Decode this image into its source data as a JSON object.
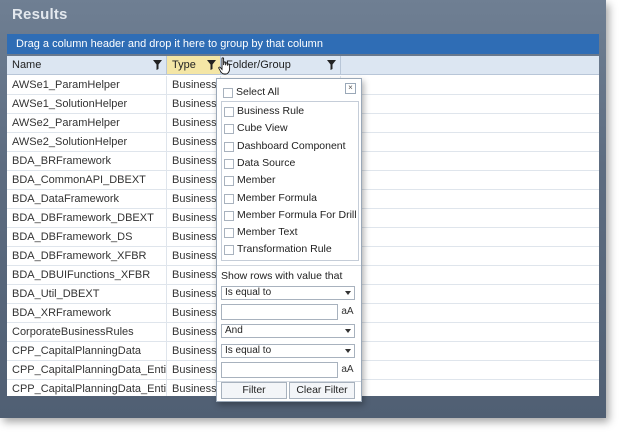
{
  "window": {
    "title": "Results"
  },
  "group_bar": {
    "text": "Drag a column header and drop it here to group by that column"
  },
  "columns": {
    "name": "Name",
    "type": "Type",
    "folder": "Folder/Group"
  },
  "rows": [
    {
      "name": "AWSe1_ParamHelper",
      "type": "Business R"
    },
    {
      "name": "AWSe1_SolutionHelper",
      "type": "Business R"
    },
    {
      "name": "AWSe2_ParamHelper",
      "type": "Business R"
    },
    {
      "name": "AWSe2_SolutionHelper",
      "type": "Business R"
    },
    {
      "name": "BDA_BRFramework",
      "type": "Business R"
    },
    {
      "name": "BDA_CommonAPI_DBEXT",
      "type": "Business R"
    },
    {
      "name": "BDA_DataFramework",
      "type": "Business R"
    },
    {
      "name": "BDA_DBFramework_DBEXT",
      "type": "Business R"
    },
    {
      "name": "BDA_DBFramework_DS",
      "type": "Business R"
    },
    {
      "name": "BDA_DBFramework_XFBR",
      "type": "Business R"
    },
    {
      "name": "BDA_DBUIFunctions_XFBR",
      "type": "Business R"
    },
    {
      "name": "BDA_Util_DBEXT",
      "type": "Business R"
    },
    {
      "name": "BDA_XRFramework",
      "type": "Business R"
    },
    {
      "name": "CorporateBusinessRules",
      "type": "Business R"
    },
    {
      "name": "CPP_CapitalPlanningData",
      "type": "Business R"
    },
    {
      "name": "CPP_CapitalPlanningData_EntityTin",
      "type": "Business R"
    },
    {
      "name": "CPP_CapitalPlanningData_EntityTout",
      "type": "Business R"
    }
  ],
  "filter": {
    "select_all": "Select All",
    "options": [
      "Business Rule",
      "Cube View",
      "Dashboard Component",
      "Data Source",
      "Member",
      "Member Formula",
      "Member Formula For Drill D",
      "Member Text",
      "Transformation Rule"
    ],
    "show_rows_label": "Show rows with value that",
    "operator1": "Is equal to",
    "logic": "And",
    "operator2": "Is equal to",
    "case_label": "aA",
    "filter_button": "Filter",
    "clear_button": "Clear Filter"
  }
}
